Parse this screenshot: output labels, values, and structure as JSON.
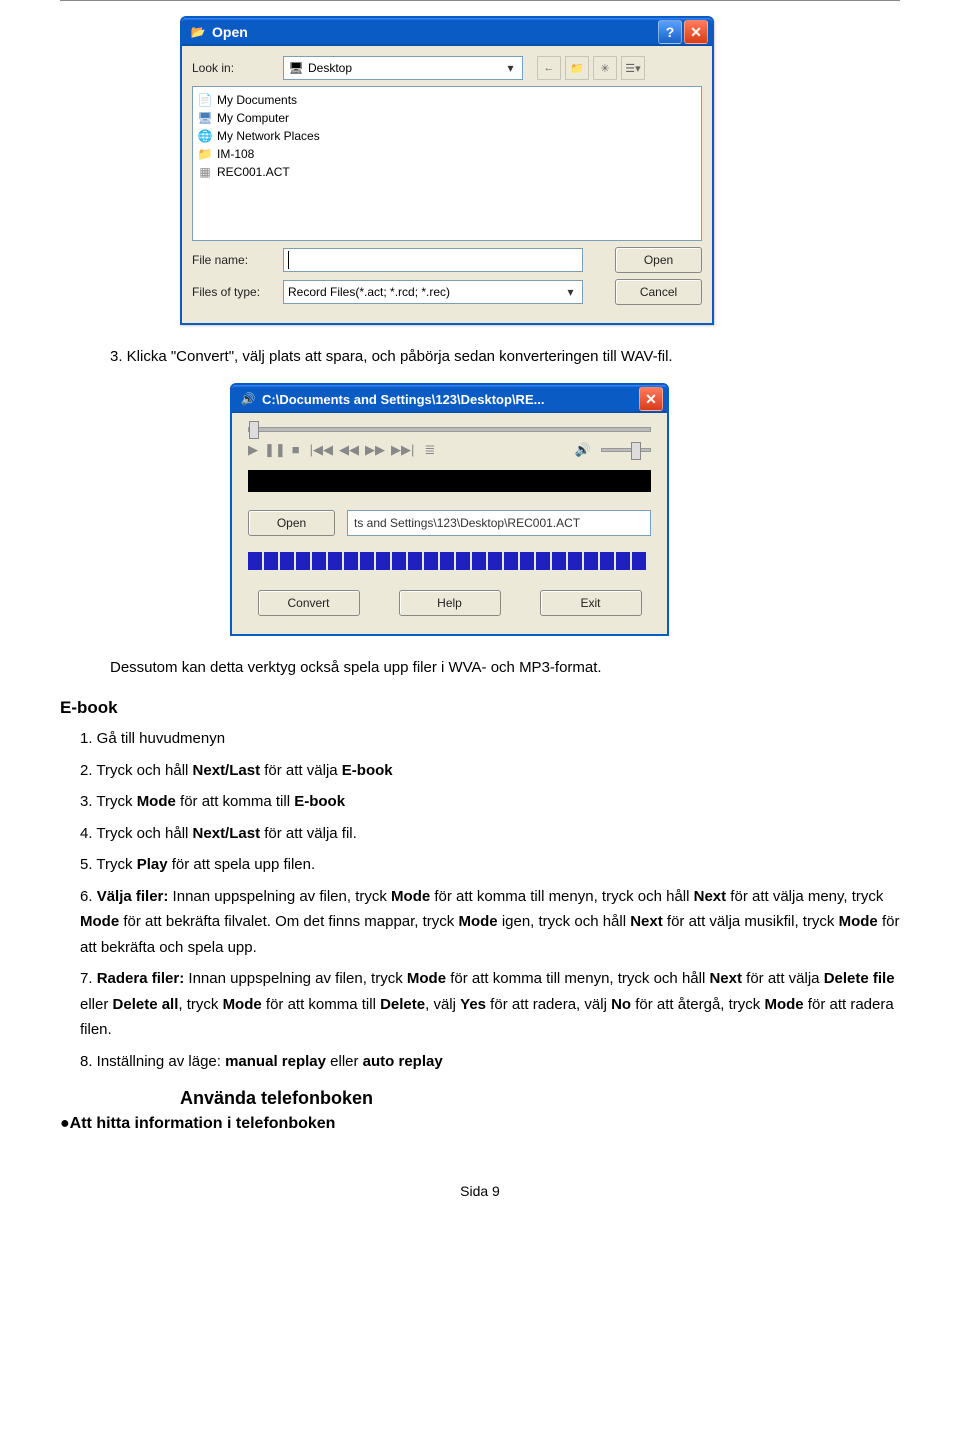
{
  "openDialog": {
    "title": "Open",
    "lookInLabel": "Look in:",
    "lookInValue": "Desktop",
    "items": [
      {
        "label": "My Documents",
        "icon": "docs-icon"
      },
      {
        "label": "My Computer",
        "icon": "computer-icon"
      },
      {
        "label": "My Network Places",
        "icon": "network-icon"
      },
      {
        "label": "IM-108",
        "icon": "folder-icon"
      },
      {
        "label": "REC001.ACT",
        "icon": "file-icon"
      }
    ],
    "fileNameLabel": "File name:",
    "fileNameValue": "",
    "filesOfTypeLabel": "Files of type:",
    "filesOfTypeValue": "Record Files(*.act; *.rcd; *.rec)",
    "openBtn": "Open",
    "cancelBtn": "Cancel"
  },
  "playerDialog": {
    "title": "C:\\Documents and Settings\\123\\Desktop\\RE...",
    "openBtn": "Open",
    "pathValue": "ts and Settings\\123\\Desktop\\REC001.ACT",
    "convertBtn": "Convert",
    "helpBtn": "Help",
    "exitBtn": "Exit"
  },
  "doc": {
    "step3": "3. Klicka \"Convert\", välj plats att spara, och påbörja sedan konverteringen till WAV-fil.",
    "afterPlayer": "Dessutom kan detta verktyg också spela upp filer i WVA- och MP3-format.",
    "ebookHeading": "E-book",
    "li1": "1. Gå till huvudmenyn",
    "li2a": "2. Tryck och håll ",
    "li2b": "Next/Last",
    "li2c": " för att välja ",
    "li2d": "E-book",
    "li3a": "3. Tryck ",
    "li3b": "Mode",
    "li3c": " för att komma till ",
    "li3d": "E-book",
    "li4a": "4. Tryck och håll ",
    "li4b": "Next/Last",
    "li4c": " för att välja fil.",
    "li5a": "5. Tryck ",
    "li5b": "Play",
    "li5c": " för att spela upp filen.",
    "li6a": "6. ",
    "li6b": "Välja filer:",
    "li6c": " Innan uppspelning av filen, tryck ",
    "li6d": "Mode",
    "li6e": " för att komma till menyn, tryck och håll ",
    "li6f": "Next",
    "li6g": " för att välja meny, tryck ",
    "li6h": "Mode",
    "li6i": " för att bekräfta filvalet. Om det finns mappar, tryck ",
    "li6j": "Mode",
    "li6k": " igen, tryck och håll ",
    "li6l": "Next",
    "li6m": " för att välja musikfil, tryck ",
    "li6n": "Mode",
    "li6o": " för att bekräfta och spela upp.",
    "li7a": "7. ",
    "li7b": "Radera filer:",
    "li7c": " Innan uppspelning av filen, tryck ",
    "li7d": "Mode",
    "li7e": " för att komma till menyn, tryck och håll ",
    "li7f": "Next",
    "li7g": " för att välja ",
    "li7h": "Delete file",
    "li7i": " eller ",
    "li7j": "Delete all",
    "li7k": ", tryck ",
    "li7l": "Mode",
    "li7m": " för att komma till ",
    "li7n": "Delete",
    "li7o": ", välj ",
    "li7p": "Yes",
    "li7q": " för att radera, välj ",
    "li7r": "No",
    "li7s": " för att återgå, tryck ",
    "li7t": "Mode",
    "li7u": " för att radera filen.",
    "li8a": "8. Inställning av läge: ",
    "li8b": "manual replay",
    "li8c": " eller ",
    "li8d": "auto replay",
    "subHeading": "Använda telefonboken",
    "bullet": "●Att hitta information i telefonboken",
    "footer": "Sida 9"
  }
}
